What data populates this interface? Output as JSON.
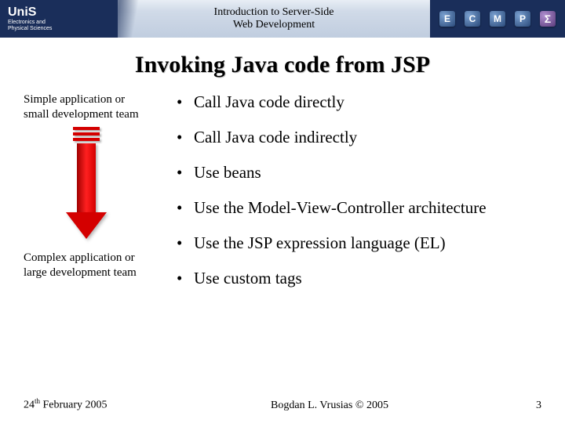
{
  "header": {
    "org": "UniS",
    "dept_line1": "Electronics and",
    "dept_line2": "Physical Sciences",
    "title_line1": "Introduction to Server-Side",
    "title_line2": "Web Development",
    "badges": [
      "E",
      "C",
      "M",
      "P",
      "Σ"
    ]
  },
  "slide": {
    "title": "Invoking Java code from JSP",
    "left_top_line1": "Simple application or",
    "left_top_line2": "small development team",
    "left_bottom_line1": "Complex application or",
    "left_bottom_line2": "large development team",
    "bullets": [
      "Call Java code directly",
      "Call Java code indirectly",
      "Use beans",
      "Use the Model-View-Controller architecture",
      "Use the JSP expression language (EL)",
      "Use custom tags"
    ]
  },
  "footer": {
    "date_day": "24",
    "date_suffix": "th",
    "date_rest": " February 2005",
    "copyright": "Bogdan L. Vrusias © 2005",
    "page": "3"
  }
}
